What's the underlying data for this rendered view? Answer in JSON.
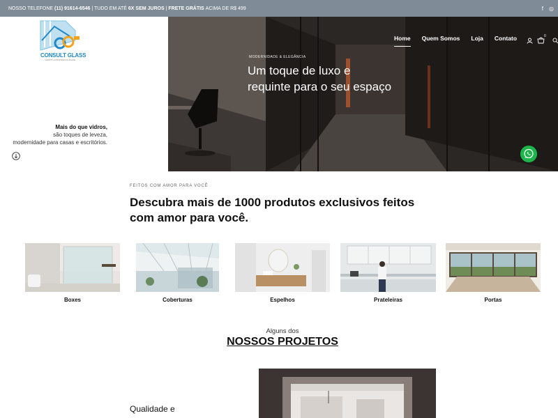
{
  "topbar": {
    "phone_label": "NOSSO TELEFONE",
    "phone": "(11) 91614-6546",
    "installments_pre": "| TUDO EM ATÉ",
    "installments": "6X SEM JUROS",
    "sep": "|",
    "shipping": "FRETE GRÁTIS",
    "shipping_post": "ACIMA DE R$ 499",
    "social": [
      "f",
      "◎"
    ]
  },
  "brand": {
    "name": "CONSULT GLASS",
    "tagline": "VIDROS COM ESPECIALIDADE"
  },
  "intro": {
    "line1": "Mais do que vidros,",
    "line2": "são toques de leveza,",
    "line3": "modernidade para casas e escritórios."
  },
  "nav": {
    "items": [
      "Home",
      "Quem Somos",
      "Loja",
      "Contato"
    ],
    "cart_count": "0"
  },
  "hero": {
    "kicker": "MODERNIDADE & ELEGÂNCIA",
    "title": "Um toque de luxo e requinte para o seu espaço"
  },
  "section": {
    "kicker": "FEITOS COM AMOR PARA VOCÊ",
    "title": "Descubra mais de 1000 produtos exclusivos feitos com amor para você."
  },
  "categories": [
    "Boxes",
    "Coberturas",
    "Espelhos",
    "Prateleiras",
    "Portas"
  ],
  "projects": {
    "kicker": "Alguns dos",
    "title": "NOSSOS PROJETOS",
    "quality": "Qualidade e"
  },
  "colors": {
    "topbar": "#7f8c97",
    "brand_blue": "#1f88c6",
    "brand_orange": "#f3a21b",
    "whatsapp": "#1cb54a"
  }
}
